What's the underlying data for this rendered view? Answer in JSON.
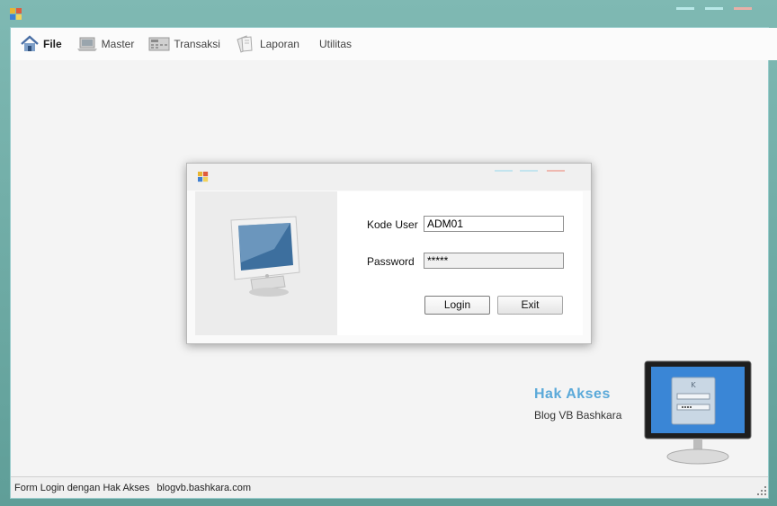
{
  "menu": {
    "items": [
      {
        "label": "File",
        "icon": "house-icon"
      },
      {
        "label": "Master",
        "icon": "laptop-icon"
      },
      {
        "label": "Transaksi",
        "icon": "calculator-icon"
      },
      {
        "label": "Laporan",
        "icon": "documents-icon"
      },
      {
        "label": "Utilitas",
        "icon": ""
      }
    ]
  },
  "login_form": {
    "kode_user_label": "Kode User",
    "kode_user_value": "ADM01",
    "password_label": "Password",
    "password_value": "*****",
    "login_button": "Login",
    "exit_button": "Exit"
  },
  "branding": {
    "title": "Hak Akses",
    "subtitle": "Blog VB Bashkara"
  },
  "status": {
    "text1": "Form Login dengan Hak Akses",
    "text2": "blogvb.bashkara.com"
  },
  "colors": {
    "accent": "#5aa9d9",
    "window_frame": "#6fa3a0"
  }
}
